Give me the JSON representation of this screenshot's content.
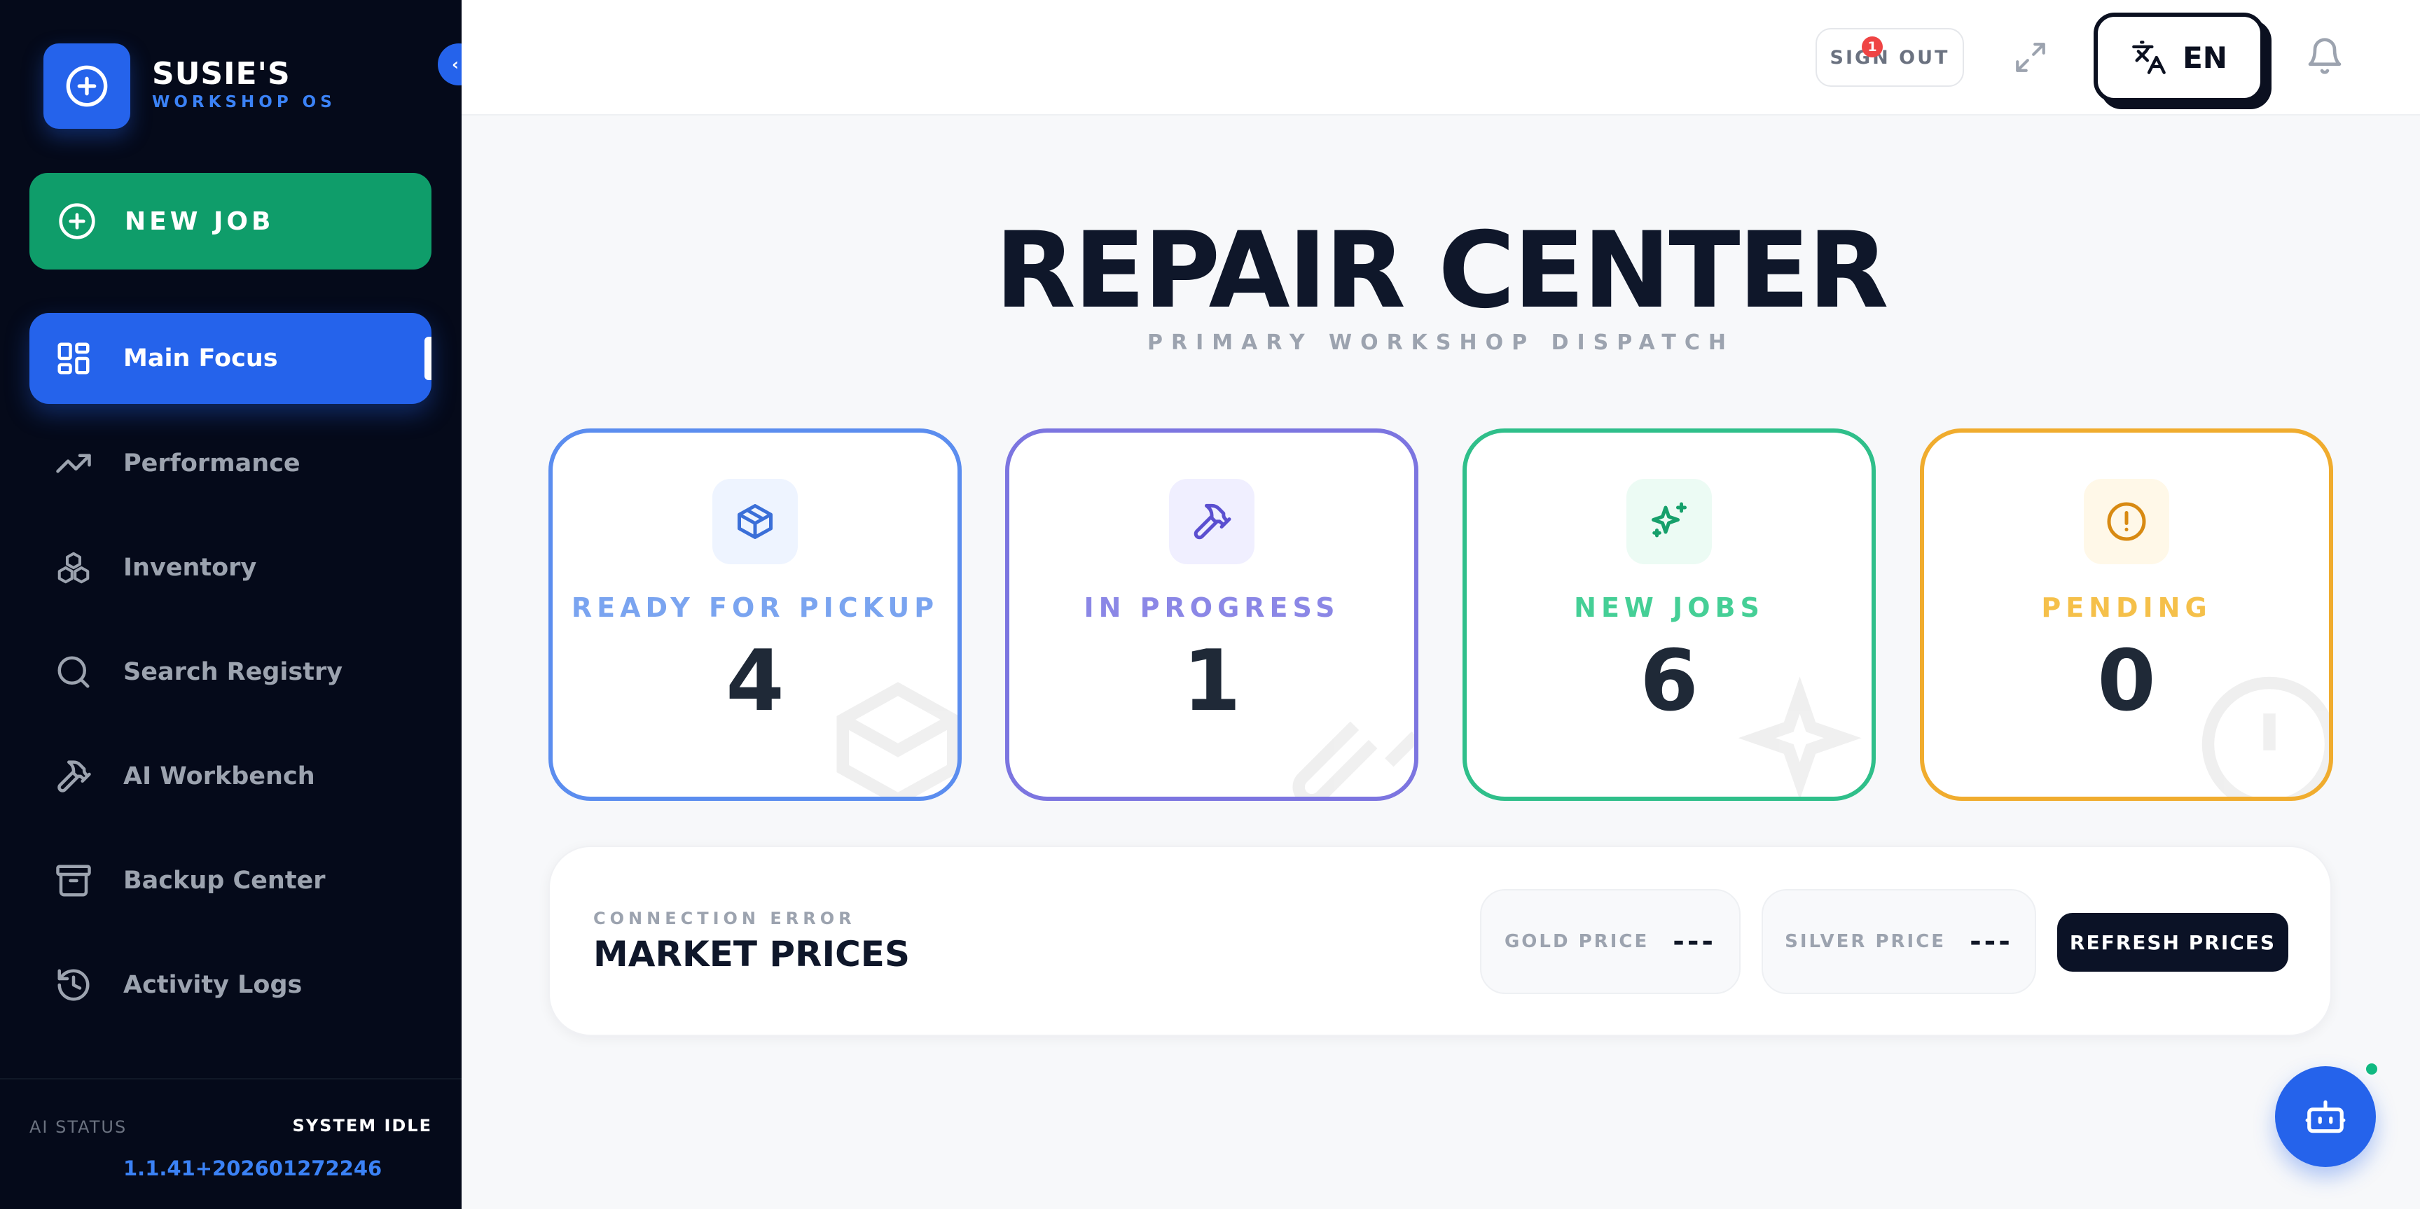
{
  "brand": {
    "name": "SUSIE'S",
    "subtitle": "WORKSHOP OS"
  },
  "sidebar": {
    "new_job_label": "NEW JOB",
    "items": [
      {
        "label": "Main Focus",
        "icon": "grid-icon",
        "active": true
      },
      {
        "label": "Performance",
        "icon": "trending-up-icon"
      },
      {
        "label": "Inventory",
        "icon": "boxes-icon"
      },
      {
        "label": "Search Registry",
        "icon": "search-icon"
      },
      {
        "label": "AI Workbench",
        "icon": "hammer-icon"
      },
      {
        "label": "Backup Center",
        "icon": "archive-icon"
      },
      {
        "label": "Activity Logs",
        "icon": "history-icon"
      }
    ],
    "footer": {
      "ai_status_label": "AI STATUS",
      "ai_status_value": "SYSTEM IDLE",
      "version": "1.1.41+202601272246"
    }
  },
  "header": {
    "sign_out_label": "SIGN OUT",
    "language": "EN",
    "notification_count": "1"
  },
  "main": {
    "title": "REPAIR CENTER",
    "subtitle": "PRIMARY WORKSHOP DISPATCH",
    "cards": [
      {
        "label": "READY FOR PICKUP",
        "value": "4",
        "icon": "package-icon",
        "color": "#5b8def",
        "label_color": "#7aa4f0",
        "icon_bg": "#eef4ff"
      },
      {
        "label": "IN PROGRESS",
        "value": "1",
        "icon": "hammer-icon",
        "color": "#7c75e0",
        "label_color": "#8b87e6",
        "icon_bg": "#f0efff"
      },
      {
        "label": "NEW JOBS",
        "value": "6",
        "icon": "sparkles-icon",
        "color": "#2fbf8a",
        "label_color": "#45cf96",
        "icon_bg": "#ecfbf4"
      },
      {
        "label": "PENDING",
        "value": "0",
        "icon": "alert-circle-icon",
        "color": "#f0ac2e",
        "label_color": "#f5c04a",
        "icon_bg": "#fff8e8"
      }
    ],
    "market": {
      "status": "CONNECTION ERROR",
      "title": "MARKET PRICES",
      "gold_label": "GOLD PRICE",
      "gold_value": "---",
      "silver_label": "SILVER PRICE",
      "silver_value": "---",
      "refresh_label": "REFRESH PRICES"
    }
  }
}
